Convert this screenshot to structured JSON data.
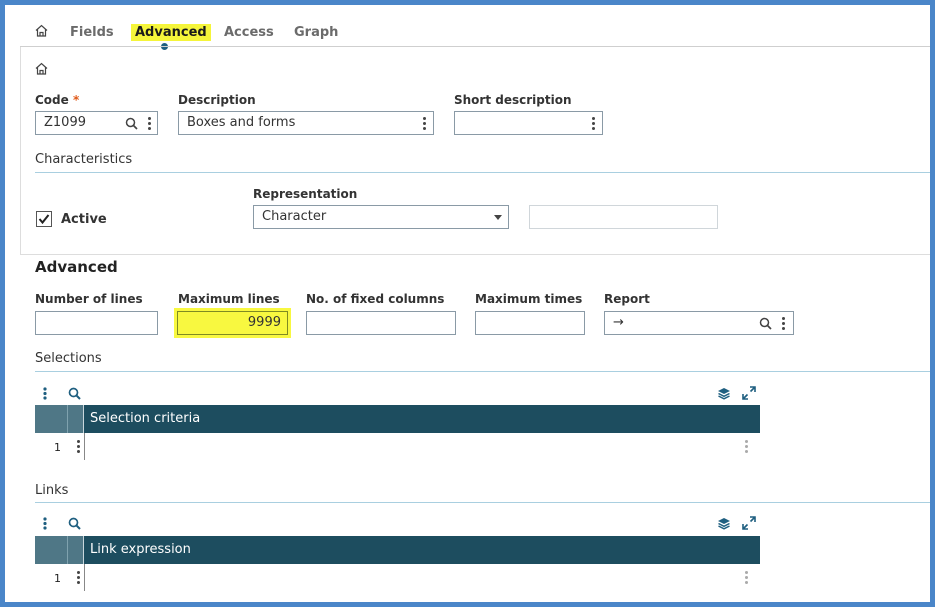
{
  "tabs": {
    "fields": "Fields",
    "advanced": "Advanced",
    "access": "Access",
    "graph": "Graph"
  },
  "header": {
    "code_label": "Code",
    "code_required": "*",
    "code_value": "Z1099",
    "description_label": "Description",
    "description_value": "Boxes and forms",
    "short_description_label": "Short description",
    "short_description_value": ""
  },
  "characteristics": {
    "title": "Characteristics",
    "active_label": "Active",
    "active_checked": true,
    "representation_label": "Representation",
    "representation_value": "Character"
  },
  "advanced": {
    "title": "Advanced",
    "number_of_lines_label": "Number of lines",
    "number_of_lines_value": "",
    "maximum_lines_label": "Maximum lines",
    "maximum_lines_value": "9999",
    "fixed_columns_label": "No. of fixed columns",
    "fixed_columns_value": "",
    "maximum_times_label": "Maximum times",
    "maximum_times_value": "",
    "report_label": "Report",
    "report_value": "→"
  },
  "selections": {
    "title": "Selections",
    "column_header": "Selection criteria",
    "row_number": "1"
  },
  "links": {
    "title": "Links",
    "column_header": "Link expression",
    "row_number": "1"
  },
  "colors": {
    "accent": "#1f5f80",
    "grid_header": "#1d4d5f",
    "highlight": "#f8f840",
    "required": "#e05a1a",
    "frame": "#4a86c9"
  }
}
